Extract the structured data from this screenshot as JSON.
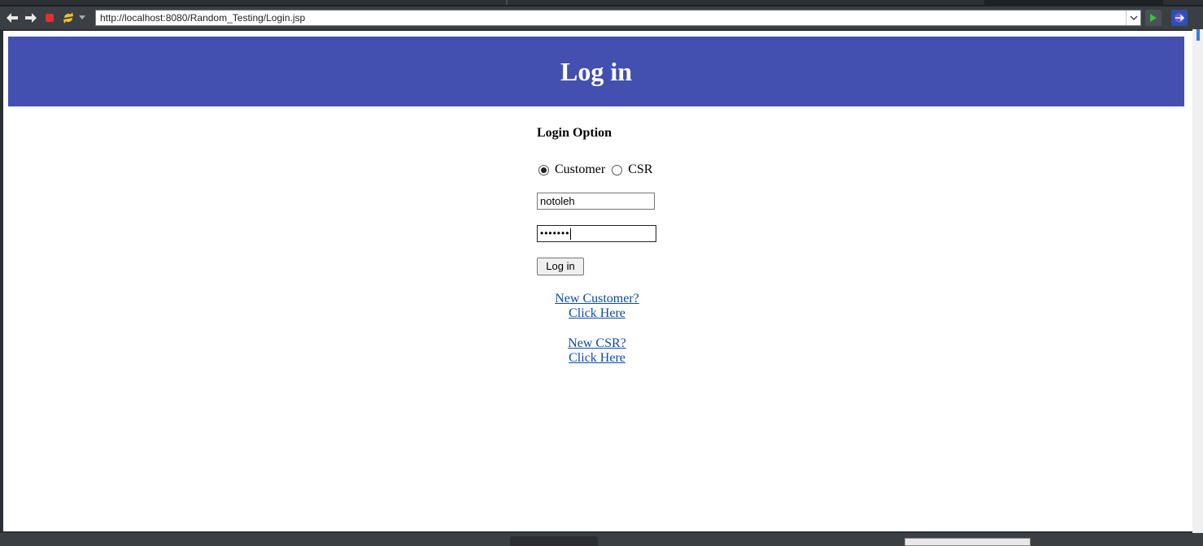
{
  "browser": {
    "url": "http://localhost:8080/Random_Testing/Login.jsp",
    "icons": [
      "back-arrow-icon",
      "forward-arrow-icon",
      "stop-icon",
      "refresh-icon",
      "dropdown-chevron-icon",
      "go-play-icon",
      "external-browser-icon"
    ]
  },
  "page": {
    "header_title": "Log in",
    "login_option_label": "Login Option",
    "radio_options": [
      {
        "label": "Customer",
        "selected": true
      },
      {
        "label": "CSR",
        "selected": false
      }
    ],
    "username_value": "notoleh",
    "password_mask": "•••••••",
    "login_button_label": "Log in",
    "new_customer_link": {
      "line1": "New Customer?",
      "line2": "Click Here"
    },
    "new_csr_link": {
      "line1": "New CSR?",
      "line2": "Click Here"
    }
  },
  "colors": {
    "header_bg": "#4350af",
    "link": "#0b4ba8",
    "toolbar_bg": "#3a3f44"
  }
}
